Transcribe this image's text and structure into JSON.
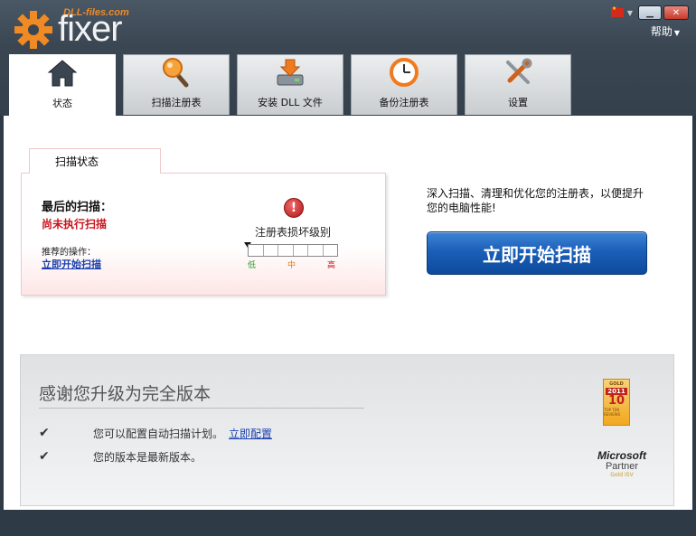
{
  "app": {
    "brand_url": "DLL-files.com",
    "brand_name": "fixer",
    "help_label": "帮助"
  },
  "tabs": [
    {
      "label": "状态",
      "icon": "home-icon",
      "active": true
    },
    {
      "label": "扫描注册表",
      "icon": "magnifier-icon",
      "active": false
    },
    {
      "label": "安装 DLL 文件",
      "icon": "install-drive-icon",
      "active": false
    },
    {
      "label": "备份注册表",
      "icon": "backup-clock-icon",
      "active": false
    },
    {
      "label": "设置",
      "icon": "tools-icon",
      "active": false
    }
  ],
  "status": {
    "tab_label": "扫描状态",
    "last_scan_label": "最后的扫描：",
    "last_scan_value": "尚未执行扫描",
    "recommend_label": "推荐的操作：",
    "recommend_link": "立即开始扫描",
    "damage_label": "注册表损坏级别",
    "meter_low": "低",
    "meter_mid": "中",
    "meter_high": "高",
    "damage_level": 0
  },
  "promo": {
    "text": "深入扫描、清理和优化您的注册表，以便提升您的电脑性能!",
    "scan_button": "立即开始扫描"
  },
  "upgrade": {
    "title": "感谢您升级为完全版本",
    "feature1": "您可以配置自动扫描计划。",
    "feature1_link": "立即配置",
    "feature2": "您的版本是最新版本。",
    "award_gold": "GOLD",
    "award_year": "2011",
    "award_top": "10",
    "award_reviews": "TOP TEN REVIEWS",
    "ms_name": "Microsoft",
    "ms_partner": "Partner",
    "ms_level": "Gold ISV"
  },
  "colors": {
    "accent": "#1b5fb8",
    "alert": "#c8141e",
    "brand_orange": "#f08a24"
  }
}
